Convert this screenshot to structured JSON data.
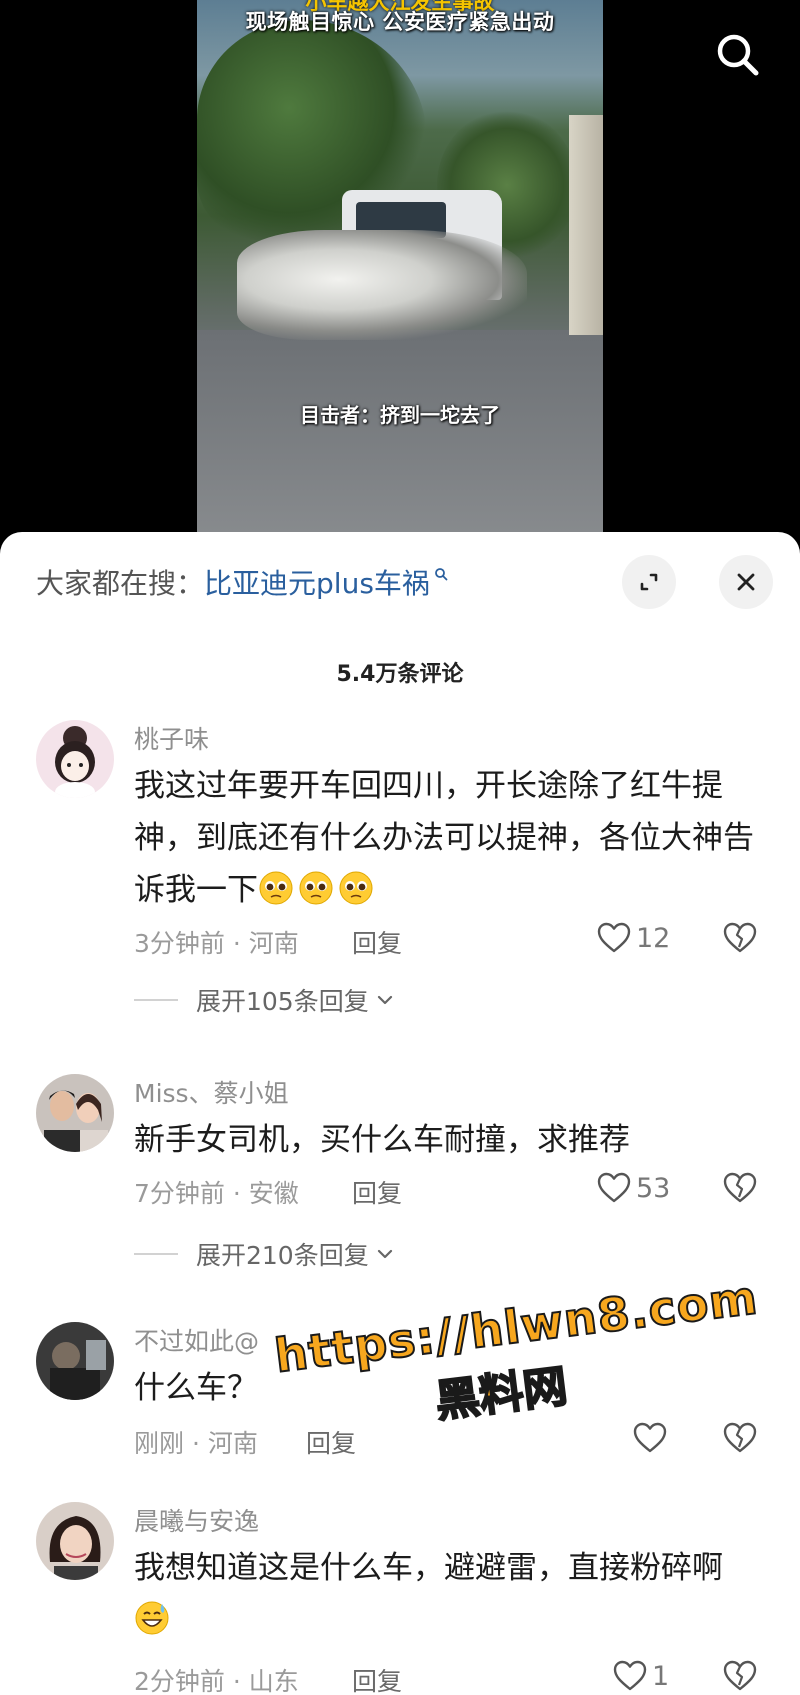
{
  "video": {
    "title_top": "小车越大江发生事故",
    "title": "现场触目惊心 公安医疗紧急出动",
    "caption": "目击者：挤到一坨去了"
  },
  "trending": {
    "prefix": "大家都在搜：",
    "query": "比亚迪元plus车祸"
  },
  "comment_count": "5.4万条评论",
  "comments": [
    {
      "username": "桃子味",
      "text": "我这过年要开车回四川，开长途除了红牛提神，到底还有什么办法可以提神，各位大神告诉我一下",
      "time_location": "3分钟前 · 河南",
      "reply_label": "回复",
      "likes": "12",
      "expand_label": "展开105条回复"
    },
    {
      "username": "Miss、蔡小姐",
      "text": "新手女司机，买什么车耐撞，求推荐",
      "time_location": "7分钟前 · 安徽",
      "reply_label": "回复",
      "likes": "53",
      "expand_label": "展开210条回复"
    },
    {
      "username": "不过如此@",
      "text": "什么车？",
      "time_location": "刚刚 · 河南",
      "reply_label": "回复",
      "likes": ""
    },
    {
      "username": "晨曦与安逸",
      "text": "我想知道这是什么车，避避雷，直接粉碎啊",
      "time_location": "2分钟前 · 山东",
      "reply_label": "回复",
      "likes": "1"
    }
  ],
  "watermark": {
    "url": "https://hlwn8.com",
    "name": "黑料网"
  },
  "colors": {
    "link": "#2a5f9e",
    "watermark": "#f7a71e",
    "sheet_bg": "#ffffff"
  },
  "icons": [
    "search-icon",
    "expand-icon",
    "close-icon",
    "heart-icon",
    "broken-heart-icon",
    "chevron-down-icon",
    "pleading-emoji",
    "grin-sweat-emoji"
  ]
}
